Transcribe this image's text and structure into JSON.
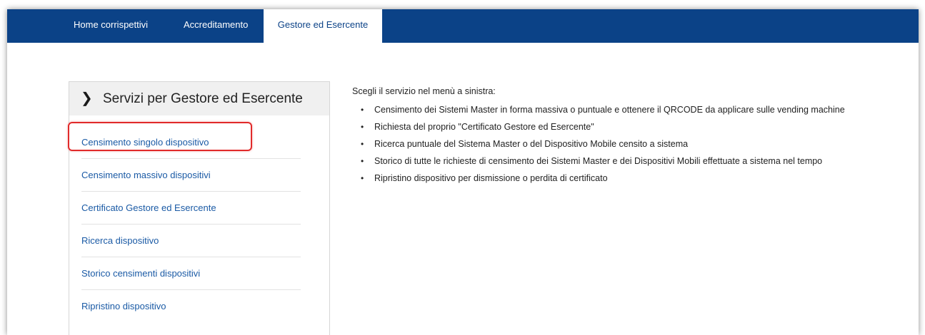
{
  "topnav": {
    "tabs": [
      {
        "label": "Home corrispettivi",
        "active": false
      },
      {
        "label": "Accreditamento",
        "active": false
      },
      {
        "label": "Gestore ed Esercente",
        "active": true
      }
    ]
  },
  "sidebar": {
    "title": "Servizi per Gestore ed Esercente",
    "chevron_icon": "chevron-right-icon",
    "items": [
      {
        "label": "Censimento singolo dispositivo",
        "highlighted": true
      },
      {
        "label": "Censimento massivo dispositivi"
      },
      {
        "label": "Certificato Gestore ed Esercente"
      },
      {
        "label": "Ricerca dispositivo"
      },
      {
        "label": "Storico censimenti dispositivi"
      },
      {
        "label": "Ripristino dispositivo"
      }
    ]
  },
  "main": {
    "intro": "Scegli il servizio nel menù a sinistra:",
    "bullets": [
      "Censimento dei Sistemi Master in forma massiva o puntuale e ottenere il QRCODE da applicare sulle vending machine",
      "Richiesta del proprio \"Certificato Gestore ed Esercente\"",
      "Ricerca puntuale del Sistema Master o del Dispositivo Mobile censito a sistema",
      "Storico di tutte le richieste di censimento dei Sistemi Master e dei Dispositivi Mobili effettuate a sistema nel tempo",
      "Ripristino dispositivo per dismissione o perdita di certificato"
    ]
  },
  "colors": {
    "nav_bg": "#0b4287",
    "link": "#1a5aa5",
    "highlight_border": "#e12a2a",
    "panel_header_bg": "#f0f0f0"
  }
}
